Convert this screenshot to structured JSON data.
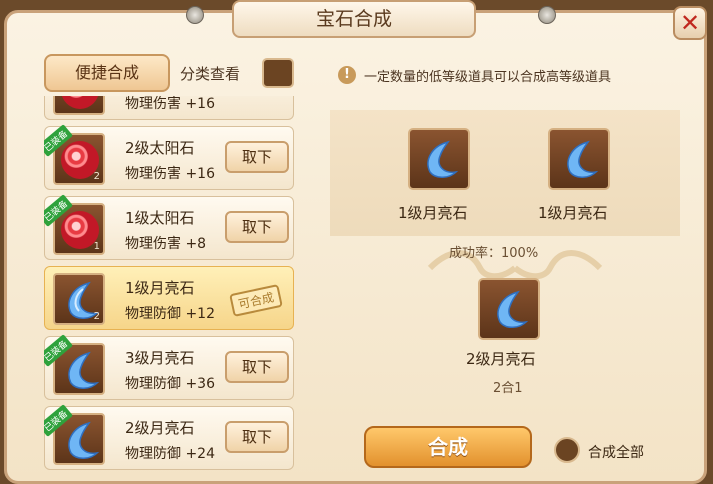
{
  "window": {
    "title": "宝石合成",
    "close_label": "✕"
  },
  "filters": {
    "quick_compose": "便捷合成",
    "category_view": "分类查看"
  },
  "inventory": {
    "items": [
      {
        "name": "",
        "stat": "物理伤害 +16",
        "equipped": false,
        "action": "",
        "partial": true
      },
      {
        "name": "2级太阳石",
        "stat": "物理伤害 +16",
        "equipped": true,
        "equipped_tag": "已装备",
        "level": "2",
        "gem": "red",
        "action": "取下"
      },
      {
        "name": "1级太阳石",
        "stat": "物理伤害 +8",
        "equipped": true,
        "equipped_tag": "已装备",
        "level": "1",
        "gem": "red",
        "action": "取下"
      },
      {
        "name": "1级月亮石",
        "stat": "物理防御 +12",
        "equipped": false,
        "level": "2",
        "gem": "blue",
        "stamp": "可合成",
        "selected": true
      },
      {
        "name": "3级月亮石",
        "stat": "物理防御 +36",
        "equipped": true,
        "equipped_tag": "已装备",
        "level": "",
        "gem": "blue",
        "action": "取下"
      },
      {
        "name": "2级月亮石",
        "stat": "物理防御 +24",
        "equipped": true,
        "equipped_tag": "已装备",
        "level": "",
        "gem": "blue",
        "action": "取下"
      }
    ]
  },
  "compose": {
    "tip": "一定数量的低等级道具可以合成高等级道具",
    "materials": [
      {
        "name": "1级月亮石"
      },
      {
        "name": "1级月亮石"
      }
    ],
    "success_rate": "成功率：100%",
    "result": {
      "name": "2级月亮石",
      "ratio": "2合1"
    },
    "compose_button": "合成",
    "compose_all": "合成全部"
  },
  "colors": {
    "accent": "#e2912d",
    "panel": "#f3e3c6",
    "equipped_tag": "#2fa23c",
    "gem_red": "#e83b43",
    "gem_blue": "#5aa8f0"
  }
}
